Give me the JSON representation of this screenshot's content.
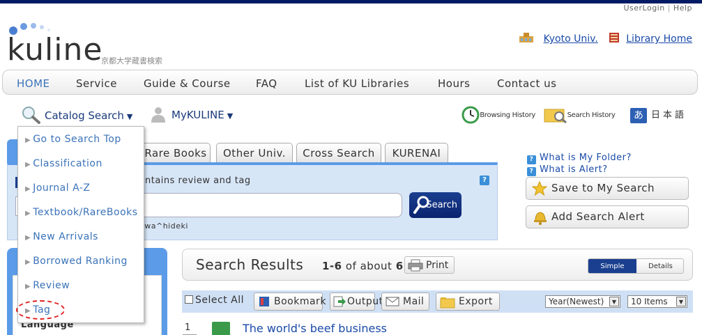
{
  "header": {
    "user_login": "UserLogin",
    "separator": "|",
    "help": "Help",
    "logo": "kuline",
    "logo_sub": "京都大学蔵書検索",
    "kyoto_univ": "Kyoto Univ.",
    "library_home": "Library Home"
  },
  "nav": {
    "items": [
      "HOME",
      "Service",
      "Guide & Course",
      "FAQ",
      "List of KU Libraries",
      "Hours",
      "Contact us"
    ]
  },
  "subnav": {
    "catalog_search": "Catalog Search",
    "mykuline": "MyKULINE",
    "browsing_history": "Browsing History",
    "search_history": "Search History",
    "lang_glyph": "あ",
    "japanese": "日本語"
  },
  "dropdown": {
    "items": [
      "Go to Search Top",
      "Classification",
      "Journal A-Z",
      "Textbook/RareBooks",
      "New Arrivals",
      "Borrowed Ranking",
      "Review",
      "Tag"
    ]
  },
  "tabs": {
    "items": [
      "Rare Books",
      "Other Univ.",
      "Cross Search",
      "KURENAI"
    ]
  },
  "search": {
    "description": "ntains review and tag",
    "help": "?",
    "button_label": "Search",
    "hint": "awa^hideki",
    "input_value": ""
  },
  "side_links": {
    "folder": "What is My Folder?",
    "alert": "What is Alert?",
    "q": "?"
  },
  "side_buttons": {
    "save_search": "Save to My Search",
    "add_alert": "Add Search Alert"
  },
  "facets": {
    "language": "Language"
  },
  "results": {
    "title": "Search Results",
    "range": "1-6",
    "of_about": "of about",
    "total": "6",
    "print": "Print",
    "simple_display": "Simple Display",
    "details_display": "Details Display",
    "select_all": "Select All",
    "bookmark": "Bookmark",
    "output": "Output",
    "mail": "Mail",
    "export": "Export",
    "sort_value": "Year(Newest)",
    "per_page_value": "10 Items",
    "first_num": "1",
    "first_title": "The world's beef business"
  },
  "colors": {
    "accent_blue": "#5b9be8",
    "link_blue": "#1a4aa8",
    "dark_navy": "#001a66",
    "search_panel": "#d7e6f7",
    "highlight_ring": "#e02020"
  }
}
